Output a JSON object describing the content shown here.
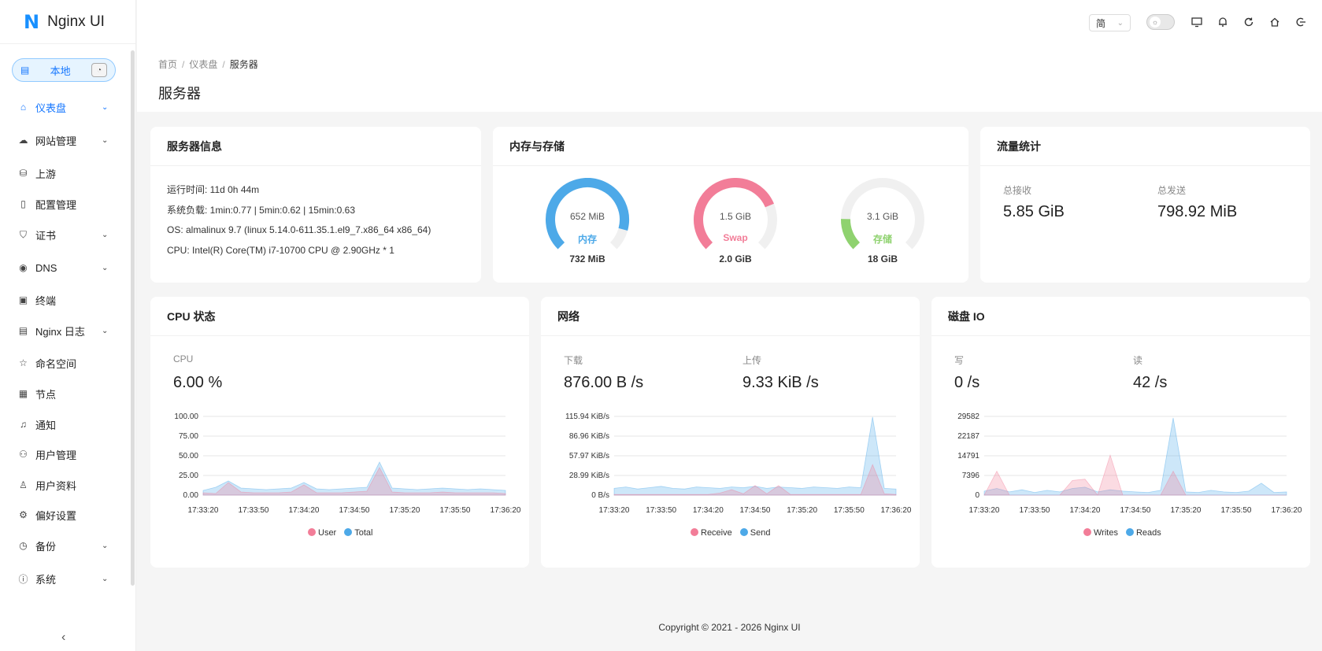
{
  "app": {
    "logo_letter": "N",
    "title": "Nginx UI"
  },
  "env": {
    "label": "本地"
  },
  "menu": [
    {
      "icon": "⌂",
      "name": "home-icon",
      "label": "仪表盘",
      "caret": "⌄",
      "active": true
    },
    {
      "icon": "☁",
      "name": "cloud-icon",
      "label": "网站管理",
      "caret": "⌄"
    },
    {
      "icon": "⛁",
      "name": "upstream-icon",
      "label": "上游",
      "caret": ""
    },
    {
      "icon": "▯",
      "name": "file-icon",
      "label": "配置管理",
      "caret": ""
    },
    {
      "icon": "⛉",
      "name": "shield-icon",
      "label": "证书",
      "caret": "⌄"
    },
    {
      "icon": "◉",
      "name": "dns-icon",
      "label": "DNS",
      "caret": "⌄"
    },
    {
      "icon": "▣",
      "name": "terminal-icon",
      "label": "终端",
      "caret": ""
    },
    {
      "icon": "▤",
      "name": "log-icon",
      "label": "Nginx 日志",
      "caret": "⌄"
    },
    {
      "icon": "☆",
      "name": "star-icon",
      "label": "命名空间",
      "caret": ""
    },
    {
      "icon": "▦",
      "name": "node-icon",
      "label": "节点",
      "caret": ""
    },
    {
      "icon": "♫",
      "name": "bell-icon",
      "label": "通知",
      "caret": ""
    },
    {
      "icon": "⚇",
      "name": "users-icon",
      "label": "用户管理",
      "caret": ""
    },
    {
      "icon": "♙",
      "name": "user-icon",
      "label": "用户资料",
      "caret": ""
    },
    {
      "icon": "⚙",
      "name": "gear-icon",
      "label": "偏好设置",
      "caret": ""
    },
    {
      "icon": "◷",
      "name": "backup-icon",
      "label": "备份",
      "caret": "⌄"
    },
    {
      "icon": "ⓘ",
      "name": "info-icon",
      "label": "系统",
      "caret": "⌄"
    }
  ],
  "header": {
    "lang": "简",
    "lang_caret": "⌄",
    "theme_knob": "☼"
  },
  "breadcrumb": [
    "首页",
    "仪表盘",
    "服务器"
  ],
  "page_title": "服务器",
  "server_info": {
    "title": "服务器信息",
    "uptime": "运行时间: 11d 0h 44m",
    "load": "系统负载: 1min:0.77 | 5min:0.62 | 15min:0.63",
    "os": "OS: almalinux 9.7 (linux 5.14.0-611.35.1.el9_7.x86_64 x86_64)",
    "cpu": "CPU: Intel(R) Core(TM) i7-10700 CPU @ 2.90GHz * 1"
  },
  "memory": {
    "title": "内存与存储",
    "gauges": [
      {
        "used": "652 MiB",
        "label": "内存",
        "total": "732 MiB",
        "fraction": 0.89,
        "color": "#4da9e8"
      },
      {
        "used": "1.5 GiB",
        "label": "Swap",
        "total": "2.0 GiB",
        "fraction": 0.75,
        "color": "#f27d98"
      },
      {
        "used": "3.1 GiB",
        "label": "存储",
        "total": "18 GiB",
        "fraction": 0.17,
        "color": "#8fd26f"
      }
    ]
  },
  "traffic": {
    "title": "流量统计",
    "recv_label": "总接收",
    "recv_value": "5.85 GiB",
    "send_label": "总发送",
    "send_value": "798.92 MiB"
  },
  "cpu_card": {
    "title": "CPU 状态",
    "label": "CPU",
    "value": "6.00 %"
  },
  "net_card": {
    "title": "网络",
    "down_label": "下载",
    "down_value": "876.00 B /s",
    "up_label": "上传",
    "up_value": "9.33 KiB /s"
  },
  "disk_card": {
    "title": "磁盘 IO",
    "write_label": "写",
    "write_value": "0 /s",
    "read_label": "读",
    "read_value": "42 /s"
  },
  "chart_data": [
    {
      "type": "area",
      "x": [
        "17:33:20",
        "17:33:50",
        "17:34:20",
        "17:34:50",
        "17:35:20",
        "17:35:50",
        "17:36:20"
      ],
      "y_ticks": [
        "100.00",
        "75.00",
        "50.00",
        "25.00",
        "0.00"
      ],
      "ylim": [
        0,
        100
      ],
      "series": [
        {
          "name": "User",
          "color": "#f27d98",
          "values": [
            3,
            2,
            16,
            4,
            3,
            3,
            3,
            4,
            13,
            3,
            3,
            3,
            4,
            5,
            35,
            4,
            3,
            3,
            3,
            4,
            3,
            3,
            3,
            3,
            2
          ]
        },
        {
          "name": "Total",
          "color": "#4da9e8",
          "values": [
            6,
            10,
            18,
            9,
            8,
            7,
            8,
            9,
            16,
            8,
            7,
            8,
            9,
            10,
            42,
            9,
            8,
            7,
            8,
            9,
            8,
            7,
            8,
            7,
            6
          ]
        }
      ]
    },
    {
      "type": "area",
      "x": [
        "17:33:20",
        "17:33:50",
        "17:34:20",
        "17:34:50",
        "17:35:20",
        "17:35:50",
        "17:36:20"
      ],
      "y_ticks": [
        "115.94 KiB/s",
        "86.96 KiB/s",
        "57.97 KiB/s",
        "28.99 KiB/s",
        "0 B/s"
      ],
      "ylim": [
        0,
        115.94
      ],
      "series": [
        {
          "name": "Receive",
          "color": "#f27d98",
          "values": [
            1,
            1,
            1,
            1,
            1,
            1,
            1,
            1,
            1,
            3,
            8,
            2,
            14,
            2,
            14,
            1,
            1,
            1,
            1,
            1,
            1,
            1,
            45,
            2,
            1
          ]
        },
        {
          "name": "Send",
          "color": "#4da9e8",
          "values": [
            10,
            12,
            9,
            11,
            13,
            10,
            9,
            12,
            11,
            10,
            12,
            11,
            13,
            10,
            12,
            11,
            10,
            12,
            11,
            10,
            12,
            11,
            115,
            10,
            9
          ]
        }
      ]
    },
    {
      "type": "area",
      "x": [
        "17:33:20",
        "17:33:50",
        "17:34:20",
        "17:34:50",
        "17:35:20",
        "17:35:50",
        "17:36:20"
      ],
      "y_ticks": [
        "29582",
        "22187",
        "14791",
        "7396",
        "0"
      ],
      "ylim": [
        0,
        29582
      ],
      "series": [
        {
          "name": "Writes",
          "color": "#f27d98",
          "values": [
            0,
            9000,
            0,
            0,
            0,
            0,
            0,
            5500,
            6000,
            0,
            15000,
            0,
            0,
            0,
            0,
            9000,
            0,
            0,
            0,
            0,
            0,
            0,
            0,
            0,
            0
          ]
        },
        {
          "name": "Reads",
          "color": "#4da9e8",
          "values": [
            1500,
            2500,
            1200,
            2000,
            1000,
            1800,
            1200,
            2500,
            3000,
            1200,
            2000,
            1500,
            1200,
            1000,
            1800,
            29000,
            1200,
            1000,
            1800,
            1200,
            1000,
            1500,
            4500,
            1000,
            1200
          ]
        }
      ]
    }
  ],
  "footer": "Copyright © 2021 - 2026 Nginx UI"
}
